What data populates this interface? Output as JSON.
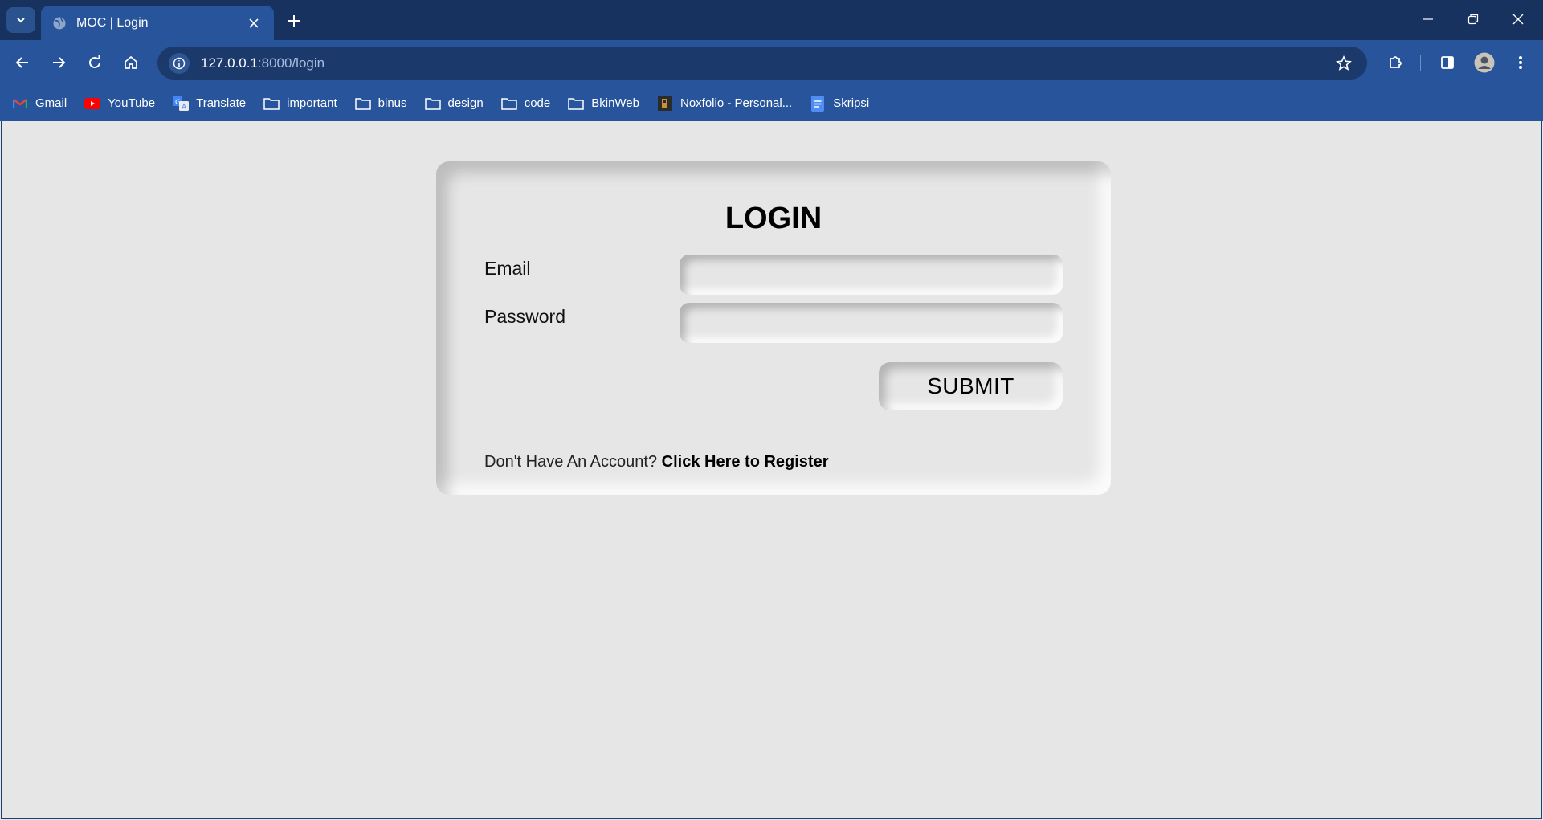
{
  "browser": {
    "tab": {
      "title": "MOC | Login"
    },
    "url": {
      "host": "127.0.0.1",
      "rest": ":8000/login"
    },
    "bookmarks": [
      {
        "label": "Gmail",
        "icon": "gmail-icon"
      },
      {
        "label": "YouTube",
        "icon": "youtube-icon"
      },
      {
        "label": "Translate",
        "icon": "translate-icon"
      },
      {
        "label": "important",
        "icon": "folder-icon"
      },
      {
        "label": "binus",
        "icon": "folder-icon"
      },
      {
        "label": "design",
        "icon": "folder-icon"
      },
      {
        "label": "code",
        "icon": "folder-icon"
      },
      {
        "label": "BkinWeb",
        "icon": "folder-icon"
      },
      {
        "label": "Noxfolio - Personal...",
        "icon": "site-favicon"
      },
      {
        "label": "Skripsi",
        "icon": "docs-icon"
      }
    ],
    "colors": {
      "frame": "#17325f",
      "toolbar": "#27549a",
      "omnibox": "#1b3a6b"
    }
  },
  "login": {
    "title": "LOGIN",
    "email_label": "Email",
    "password_label": "Password",
    "email_value": "",
    "password_value": "",
    "submit_label": "SUBMIT",
    "register_prompt": "Don't Have An Account?",
    "register_link": "Click Here to Register"
  }
}
